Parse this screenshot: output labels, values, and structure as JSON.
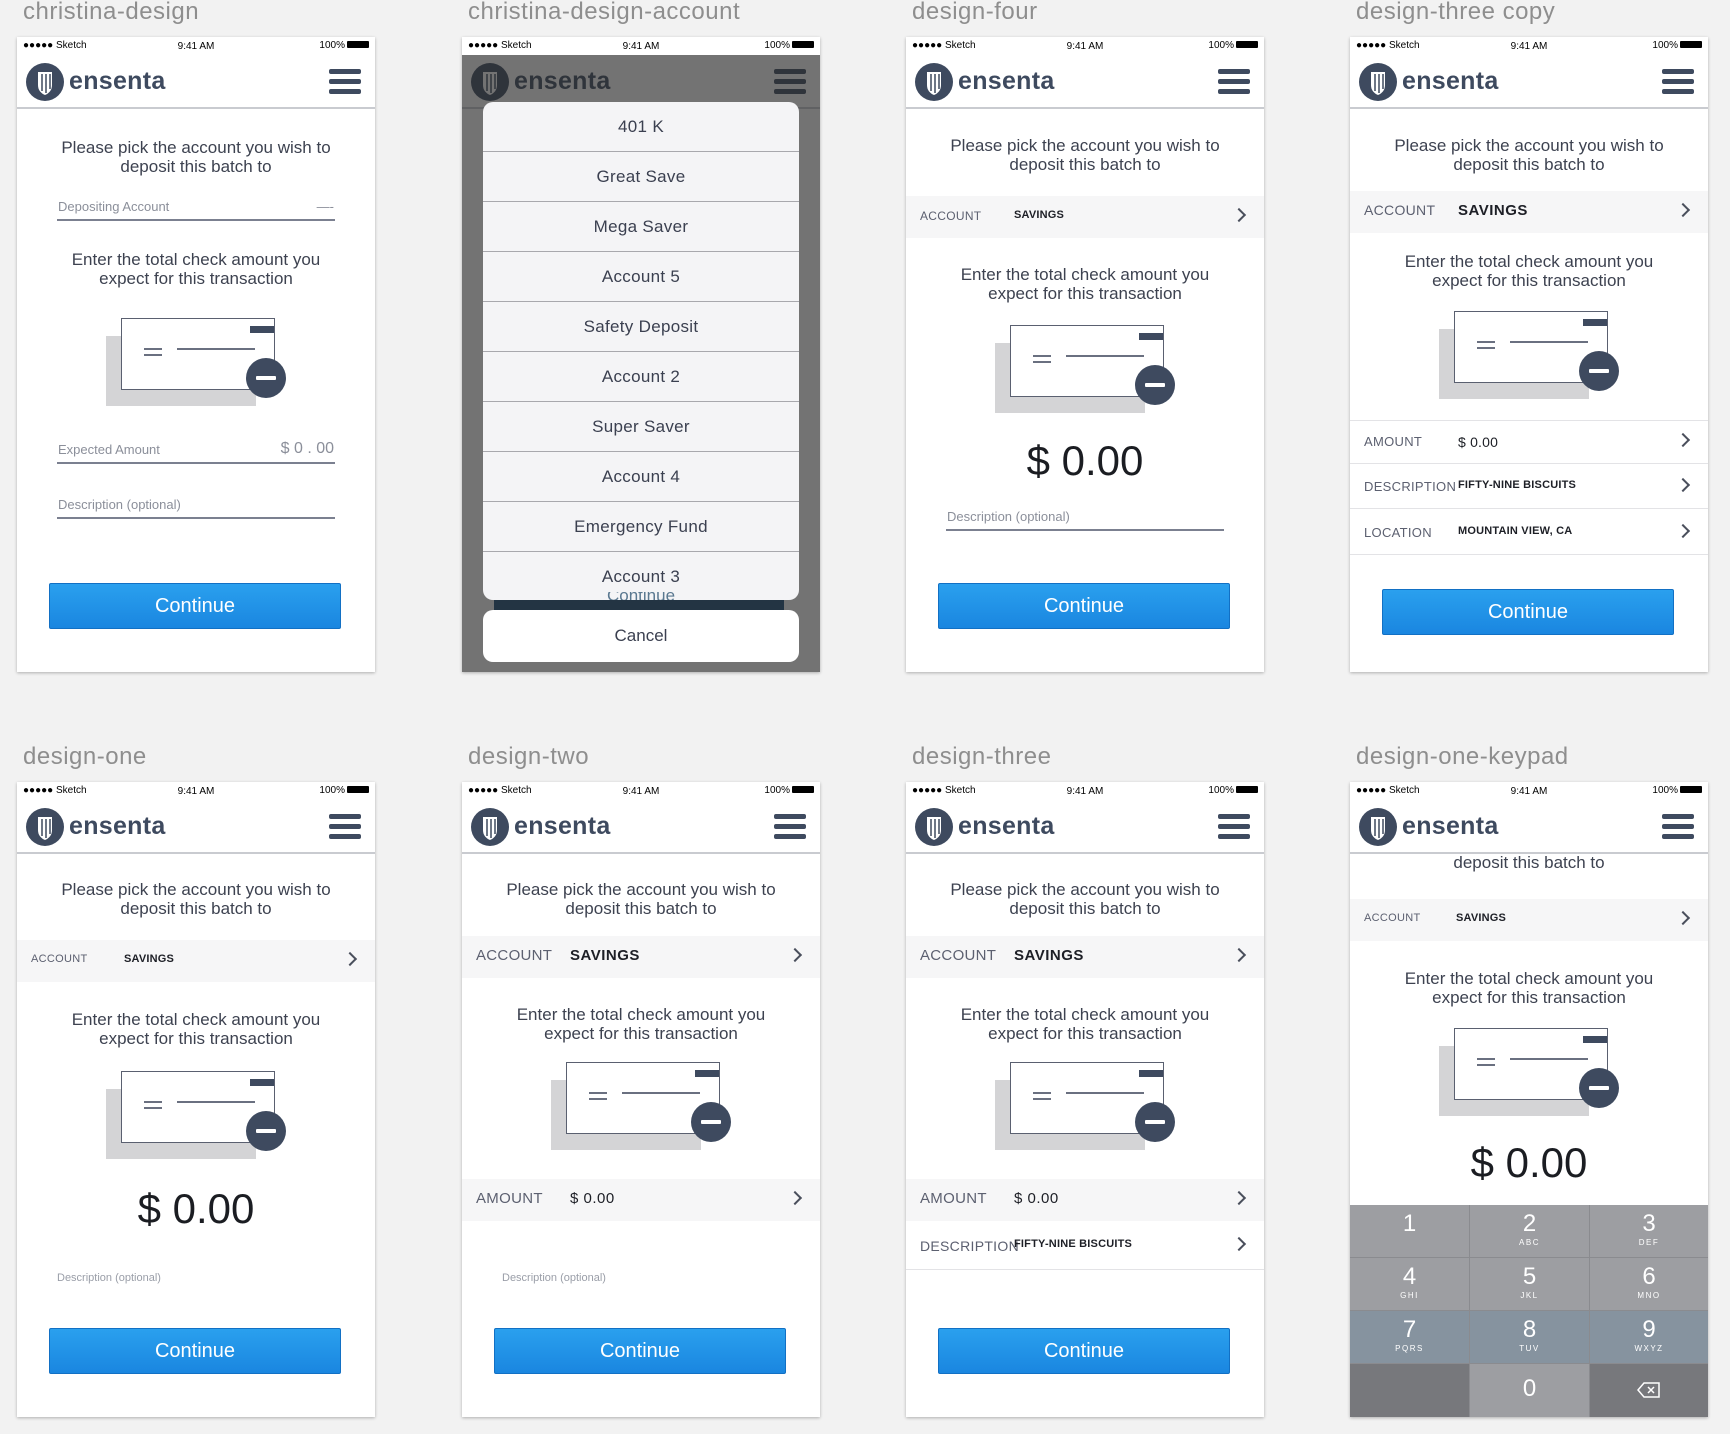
{
  "status_bar": {
    "carrier": "●●●●● Sketch",
    "time": "9:41 AM",
    "battery": "100%"
  },
  "brand": "ensenta",
  "colors": {
    "brand_navy": "#3e4a5f",
    "cta_blue": "#1a86e0",
    "row_bg": "#f6f6f7"
  },
  "common": {
    "pick_prompt_1": "Please pick the account you wish to",
    "pick_prompt_2": "deposit this batch to",
    "amount_prompt_1": "Enter the total check amount you",
    "amount_prompt_2": "expect for this transaction",
    "continue": "Continue",
    "description_optional": "Description (optional)",
    "account_label": "ACCOUNT",
    "account_value": "SAVINGS",
    "amount_label": "AMOUNT",
    "amount_value": "$ 0.00",
    "description_label": "DESCRIPTION",
    "description_value": "FIFTY-NINE BISCUITS",
    "location_label": "LOCATION",
    "location_value": "MOUNTAIN VIEW, CA",
    "big_amount": "$ 0.00"
  },
  "artboards": {
    "christina_design": {
      "title": "christina-design",
      "depositing_label": "Depositing Account",
      "depositing_value": "—-",
      "expected_label": "Expected Amount",
      "expected_value": "$ 0 . 00"
    },
    "christina_design_account": {
      "title": "christina-design-account",
      "options": [
        "401 K",
        "Great Save",
        "Mega Saver",
        "Account 5",
        "Safety Deposit",
        "Account 2",
        "Super Saver",
        "Account 4",
        "Emergency Fund",
        "Account 3"
      ],
      "ghost_continue": "Continue",
      "cancel": "Cancel"
    },
    "design_four": {
      "title": "design-four"
    },
    "design_three_copy": {
      "title": "design-three copy"
    },
    "design_one": {
      "title": "design-one"
    },
    "design_two": {
      "title": "design-two"
    },
    "design_three": {
      "title": "design-three"
    },
    "design_one_keypad": {
      "title": "design-one-keypad",
      "keys": [
        {
          "digit": "1",
          "letters": ""
        },
        {
          "digit": "2",
          "letters": "ABC"
        },
        {
          "digit": "3",
          "letters": "DEF"
        },
        {
          "digit": "4",
          "letters": "GHI"
        },
        {
          "digit": "5",
          "letters": "JKL"
        },
        {
          "digit": "6",
          "letters": "MNO"
        },
        {
          "digit": "7",
          "letters": "PQRS"
        },
        {
          "digit": "8",
          "letters": "TUV"
        },
        {
          "digit": "9",
          "letters": "WXYZ"
        },
        {
          "digit": "0",
          "letters": ""
        }
      ],
      "backspace_icon": "backspace-icon"
    }
  }
}
